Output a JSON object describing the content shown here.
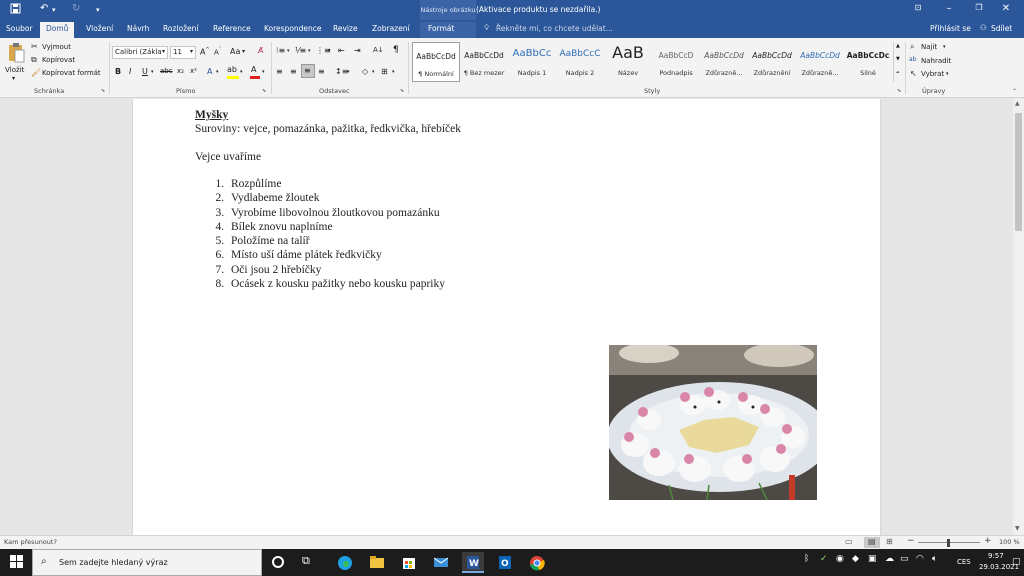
{
  "titlebar": {
    "title": "Myšky - Word (Aktivace produktu se nezdařila.)",
    "context_tab_group": "Nástroje obrázku",
    "save_icon": "save-icon",
    "undo_icon": "undo-icon",
    "redo_icon": "redo-icon"
  },
  "tabs": {
    "file": "Soubor",
    "home": "Domů",
    "insert": "Vložení",
    "design": "Návrh",
    "layout": "Rozložení",
    "references": "Reference",
    "mailings": "Korespondence",
    "review": "Revize",
    "view": "Zobrazení",
    "format": "Formát",
    "tell_me": "Řekněte mi, co chcete udělat...",
    "sign_in": "Přihlásit se",
    "share": "Sdílet"
  },
  "ribbon": {
    "clipboard": {
      "paste": "Vložit",
      "cut": "Vyjmout",
      "copy": "Kopírovat",
      "format_painter": "Kopírovat formát",
      "label": "Schránka"
    },
    "font": {
      "font_name": "Calibri (Zákla",
      "font_size": "11",
      "label": "Písmo"
    },
    "paragraph": {
      "label": "Odstavec"
    },
    "styles": {
      "label": "Styly",
      "items": [
        {
          "preview": "AaBbCcDd",
          "name": "¶ Normální"
        },
        {
          "preview": "AaBbCcDd",
          "name": "¶ Bez mezer"
        },
        {
          "preview": "AaBbCc",
          "name": "Nadpis 1"
        },
        {
          "preview": "AaBbCcC",
          "name": "Nadpis 2"
        },
        {
          "preview": "AaB",
          "name": "Název"
        },
        {
          "preview": "AaBbCcD",
          "name": "Podnadpis"
        },
        {
          "preview": "AaBbCcDd",
          "name": "Zdůrazně..."
        },
        {
          "preview": "AaBbCcDd",
          "name": "Zdůraznění"
        },
        {
          "preview": "AaBbCcDd",
          "name": "Zdůrazně..."
        },
        {
          "preview": "AaBbCcDc",
          "name": "Silné"
        }
      ]
    },
    "editing": {
      "find": "Najít",
      "replace": "Nahradit",
      "select": "Vybrat",
      "label": "Úpravy"
    }
  },
  "document": {
    "heading": "Myšky",
    "ingredients": "Suroviny: vejce, pomazánka, pažitka, ředkvička, hřebíček",
    "intro": "Vejce uvaříme",
    "steps": [
      "Rozpůlíme",
      "Vydlabeme žloutek",
      "Vyrobíme libovolnou žloutkovou pomazánku",
      "Bílek znovu naplníme",
      "Položíme na talíř",
      "Místo uší dáme plátek ředkvičky",
      "Oči jsou 2 hřebíčky",
      "Ocásek z kousku pažitky nebo kousku papriky"
    ]
  },
  "statusbar": {
    "status_text": "Kam přesunout?",
    "zoom": "100 %"
  },
  "taskbar": {
    "search_placeholder": "Sem zadejte hledaný výraz",
    "language": "CES",
    "time": "9:57",
    "date": "29.03.2021"
  }
}
